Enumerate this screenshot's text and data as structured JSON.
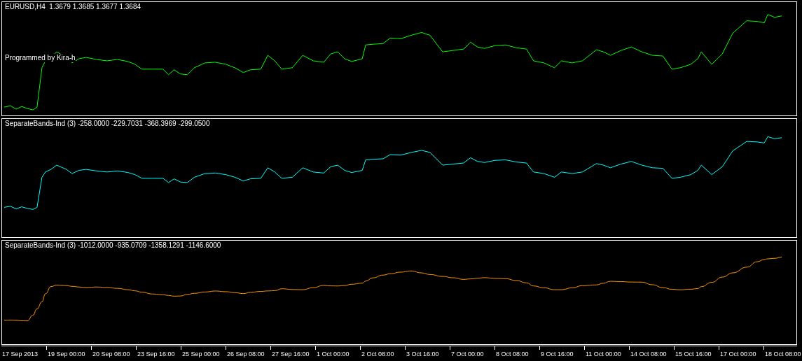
{
  "panes": [
    {
      "header": "EURUSD,H4  1.3679 1.3685 1.3677 1.3684",
      "note": "Programmed by Kira-h",
      "color": "#00ff00",
      "smooth": false
    },
    {
      "header": "SeparateBands-Ind (3) -258.0000 -229.7031 -368.3969 -299.0500",
      "color": "#00ffff",
      "smooth": false
    },
    {
      "header": "SeparateBands-Ind (3) -1012.0000 -935.0709 -1358.1291 -1146.6000",
      "color": "#ff9900",
      "smooth": true
    }
  ],
  "time_axis": {
    "labels": [
      "17 Sep 2013",
      "19 Sep 00:00",
      "20 Sep 08:00",
      "23 Sep 16:00",
      "25 Sep 00:00",
      "26 Sep 08:00",
      "27 Sep 16:00",
      "1 Oct 00:00",
      "2 Oct 08:00",
      "3 Oct 16:00",
      "7 Oct 00:00",
      "8 Oct 08:00",
      "9 Oct 16:00",
      "11 Oct 00:00",
      "14 Oct 08:00",
      "15 Oct 16:00",
      "17 Oct 00:00",
      "18 Oct 08:00"
    ]
  }
}
